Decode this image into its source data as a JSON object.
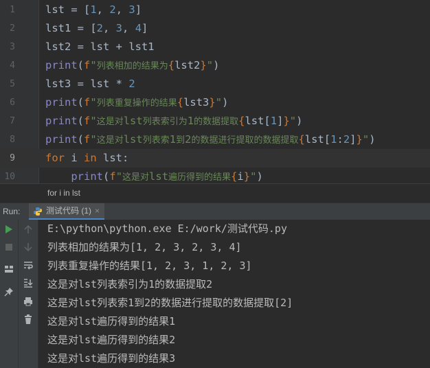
{
  "editor": {
    "lines": [
      {
        "n": "1",
        "segs": [
          [
            "t",
            "lst = ["
          ],
          [
            "n",
            "1"
          ],
          [
            "t",
            ", "
          ],
          [
            "n",
            "2"
          ],
          [
            "t",
            ", "
          ],
          [
            "n",
            "3"
          ],
          [
            "t",
            "]"
          ]
        ]
      },
      {
        "n": "2",
        "segs": [
          [
            "t",
            "lst1 = ["
          ],
          [
            "n",
            "2"
          ],
          [
            "t",
            ", "
          ],
          [
            "n",
            "3"
          ],
          [
            "t",
            ", "
          ],
          [
            "n",
            "4"
          ],
          [
            "t",
            "]"
          ]
        ]
      },
      {
        "n": "3",
        "segs": [
          [
            "t",
            "lst2 = lst + lst1"
          ]
        ]
      },
      {
        "n": "4",
        "segs": [
          [
            "b",
            "print"
          ],
          [
            "t",
            "("
          ],
          [
            "k",
            "f"
          ],
          [
            "s",
            "\""
          ],
          [
            "c",
            "列表相加的结果为"
          ],
          [
            "k",
            "{"
          ],
          [
            "t",
            "lst2"
          ],
          [
            "k",
            "}"
          ],
          [
            "s",
            "\""
          ],
          [
            "t",
            ")"
          ]
        ]
      },
      {
        "n": "5",
        "segs": [
          [
            "t",
            "lst3 = lst * "
          ],
          [
            "n",
            "2"
          ]
        ]
      },
      {
        "n": "6",
        "segs": [
          [
            "b",
            "print"
          ],
          [
            "t",
            "("
          ],
          [
            "k",
            "f"
          ],
          [
            "s",
            "\""
          ],
          [
            "c",
            "列表重复操作的结果"
          ],
          [
            "k",
            "{"
          ],
          [
            "t",
            "lst3"
          ],
          [
            "k",
            "}"
          ],
          [
            "s",
            "\""
          ],
          [
            "t",
            ")"
          ]
        ]
      },
      {
        "n": "7",
        "segs": [
          [
            "b",
            "print"
          ],
          [
            "t",
            "("
          ],
          [
            "k",
            "f"
          ],
          [
            "s",
            "\""
          ],
          [
            "c",
            "这是对"
          ],
          [
            "s",
            "lst"
          ],
          [
            "c",
            "列表索引为"
          ],
          [
            "s",
            "1"
          ],
          [
            "c",
            "的数据提取"
          ],
          [
            "k",
            "{"
          ],
          [
            "t",
            "lst["
          ],
          [
            "n",
            "1"
          ],
          [
            "t",
            "]"
          ],
          [
            "k",
            "}"
          ],
          [
            "s",
            "\""
          ],
          [
            "t",
            ")"
          ]
        ]
      },
      {
        "n": "8",
        "segs": [
          [
            "b",
            "print"
          ],
          [
            "t",
            "("
          ],
          [
            "k",
            "f"
          ],
          [
            "s",
            "\""
          ],
          [
            "c",
            "这是对"
          ],
          [
            "s",
            "lst"
          ],
          [
            "c",
            "列表索"
          ],
          [
            "s",
            "1"
          ],
          [
            "c",
            "到"
          ],
          [
            "s",
            "2"
          ],
          [
            "c",
            "的数据进行提取的数据提取"
          ],
          [
            "k",
            "{"
          ],
          [
            "t",
            "lst["
          ],
          [
            "n",
            "1"
          ],
          [
            "t",
            ":"
          ],
          [
            "n",
            "2"
          ],
          [
            "t",
            "]"
          ],
          [
            "k",
            "}"
          ],
          [
            "s",
            "\""
          ],
          [
            "t",
            ")"
          ]
        ]
      },
      {
        "n": "9",
        "current": true,
        "segs": [
          [
            "k",
            "for"
          ],
          [
            "t",
            " i "
          ],
          [
            "k",
            "in"
          ],
          [
            "t",
            " lst:"
          ]
        ]
      },
      {
        "n": "10",
        "segs": [
          [
            "t",
            "    "
          ],
          [
            "b",
            "print"
          ],
          [
            "t",
            "("
          ],
          [
            "k",
            "f"
          ],
          [
            "s",
            "\""
          ],
          [
            "c",
            "这是对"
          ],
          [
            "s",
            "lst"
          ],
          [
            "c",
            "遍历得到的结果"
          ],
          [
            "k",
            "{"
          ],
          [
            "t",
            "i"
          ],
          [
            "k",
            "}"
          ],
          [
            "s",
            "\""
          ],
          [
            "t",
            ")"
          ]
        ]
      }
    ]
  },
  "breadcrumb": "for i in lst",
  "run": {
    "label": "Run:",
    "tab_label": "测试代码 (1)",
    "tab_close": "×"
  },
  "output": [
    "E:\\python\\python.exe E:/work/测试代码.py",
    "列表相加的结果为[1, 2, 3, 2, 3, 4]",
    "列表重复操作的结果[1, 2, 3, 1, 2, 3]",
    "这是对lst列表索引为1的数据提取2",
    "这是对lst列表索1到2的数据进行提取的数据提取[2]",
    "这是对lst遍历得到的结果1",
    "这是对lst遍历得到的结果2",
    "这是对lst遍历得到的结果3"
  ],
  "colors": {
    "keyword": "#cc7832",
    "number": "#6897bb",
    "builtin": "#8888c6",
    "string": "#6a8759",
    "text": "#a9b7c6",
    "run_green": "#499c54"
  },
  "icons": [
    "run-icon",
    "stop-icon",
    "layout-icon",
    "pin-icon",
    "up-arrow-icon",
    "down-arrow-icon",
    "soft-wrap-icon",
    "scroll-to-end-icon",
    "print-icon",
    "trash-icon",
    "python-icon"
  ]
}
